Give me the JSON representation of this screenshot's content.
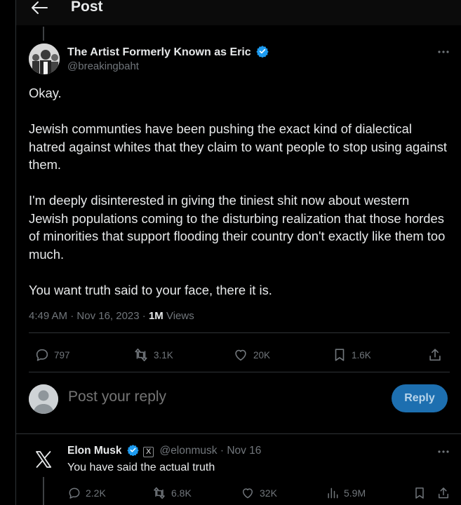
{
  "header": {
    "title": "Post"
  },
  "post": {
    "author_name": "The Artist Formerly Known as Eric",
    "author_handle": "@breakingbaht",
    "paragraphs": [
      "Okay.",
      "Jewish communties have been pushing the exact kind of dialectical hatred against whites that they claim to want people to stop using against them.",
      "I'm deeply disinterested in giving the tiniest shit now about western Jewish populations coming to the disturbing realization that those hordes of minorities that support flooding their country don't exactly like them too much.",
      "You want truth said to your face, there it is."
    ],
    "time": "4:49 AM",
    "date": "Nov 16, 2023",
    "views_count": "1M",
    "views_label": "Views",
    "stats": {
      "replies": "797",
      "reposts": "3.1K",
      "likes": "20K",
      "bookmarks": "1.6K"
    }
  },
  "reply_composer": {
    "placeholder": "Post your reply",
    "button_label": "Reply"
  },
  "reply": {
    "author_name": "Elon Musk",
    "affiliate_badge": "X",
    "author_handle": "@elonmusk",
    "date": "Nov 16",
    "text": "You have said the actual truth",
    "stats": {
      "replies": "2.2K",
      "reposts": "6.8K",
      "likes": "32K",
      "views": "5.9M"
    }
  },
  "colors": {
    "background": "#000000",
    "text": "#e7e9ea",
    "muted": "#71767b",
    "accent": "#1d9bf0",
    "divider": "#2f3336"
  },
  "icons": [
    "back-arrow-icon",
    "verified-badge-icon",
    "more-icon",
    "reply-icon",
    "repost-icon",
    "like-icon",
    "bookmark-icon",
    "share-icon",
    "views-icon",
    "x-logo-icon"
  ]
}
